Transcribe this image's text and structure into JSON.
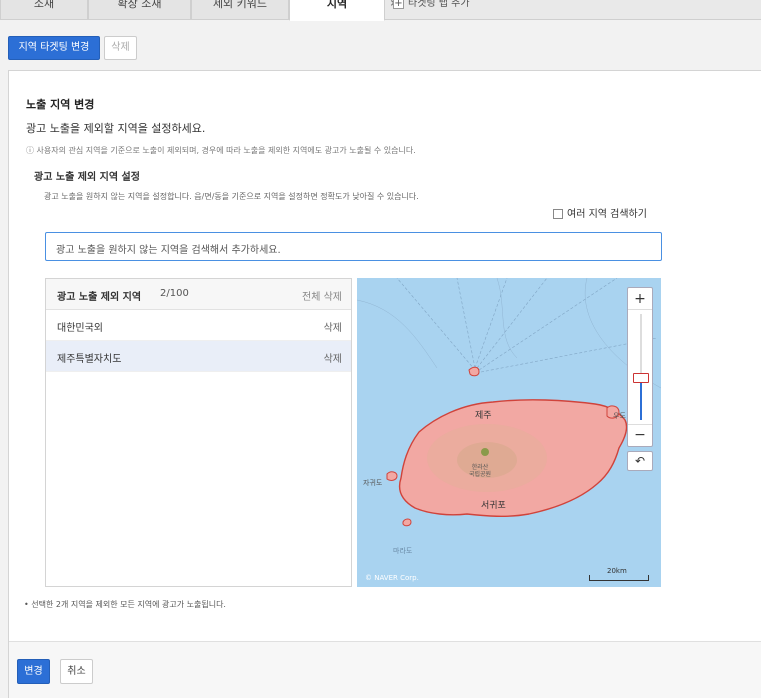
{
  "tabs": {
    "items": [
      {
        "label": "소재"
      },
      {
        "label": "확장 소재"
      },
      {
        "label": "제외 키워드"
      },
      {
        "label": "지역"
      }
    ],
    "add_label": "타겟팅 탭 추가"
  },
  "actions": {
    "change_targeting": "지역 타겟팅 변경",
    "delete": "삭제"
  },
  "section": {
    "title": "노출 지역 변경",
    "subtitle": "광고 노출을 제외할 지역을 설정하세요.",
    "notice": "ⓘ 사용자의 관심 지역을 기준으로 노출이 제외되며, 경우에 따라 노출을 제외한 지역에도 광고가 노출될 수 있습니다.",
    "setting_title": "광고 노출 제외 지역 설정",
    "setting_desc": "광고 노출을 원하지 않는 지역을 설정합니다. 읍/면/동을 기준으로 지역을 설정하면 정확도가 낮아질 수 있습니다.",
    "multi_search_label": "여러 지역 검색하기",
    "search_placeholder": "광고 노출을 원하지 않는 지역을 검색해서 추가하세요."
  },
  "exclusion_list": {
    "title": "광고 노출 제외 지역",
    "count": "2/100",
    "delete_all": "전체 삭제",
    "rows": [
      {
        "name": "대한민국외",
        "action": "삭제"
      },
      {
        "name": "제주특별자치도",
        "action": "삭제"
      }
    ]
  },
  "map": {
    "labels": {
      "jeju": "제주",
      "seogwipo": "서귀포",
      "hallasan": "한라산\n국립공원",
      "jagwido": "자귀도",
      "marado": "마라도",
      "udo": "우도"
    },
    "copyright": "© NAVER Corp.",
    "scale": "20km",
    "zoom_in": "+",
    "zoom_out": "−",
    "reset": "↶",
    "zoom_level": 0.4
  },
  "summary": "• 선택한 2개 지역을 제외한 모든 지역에 광고가 노출됩니다.",
  "footer": {
    "submit": "변경",
    "cancel": "취소"
  },
  "colors": {
    "primary": "#2c6fd6",
    "map_water": "#a9d3f0",
    "island_fill": "#f2a8a3",
    "island_stroke": "#d0433b"
  }
}
